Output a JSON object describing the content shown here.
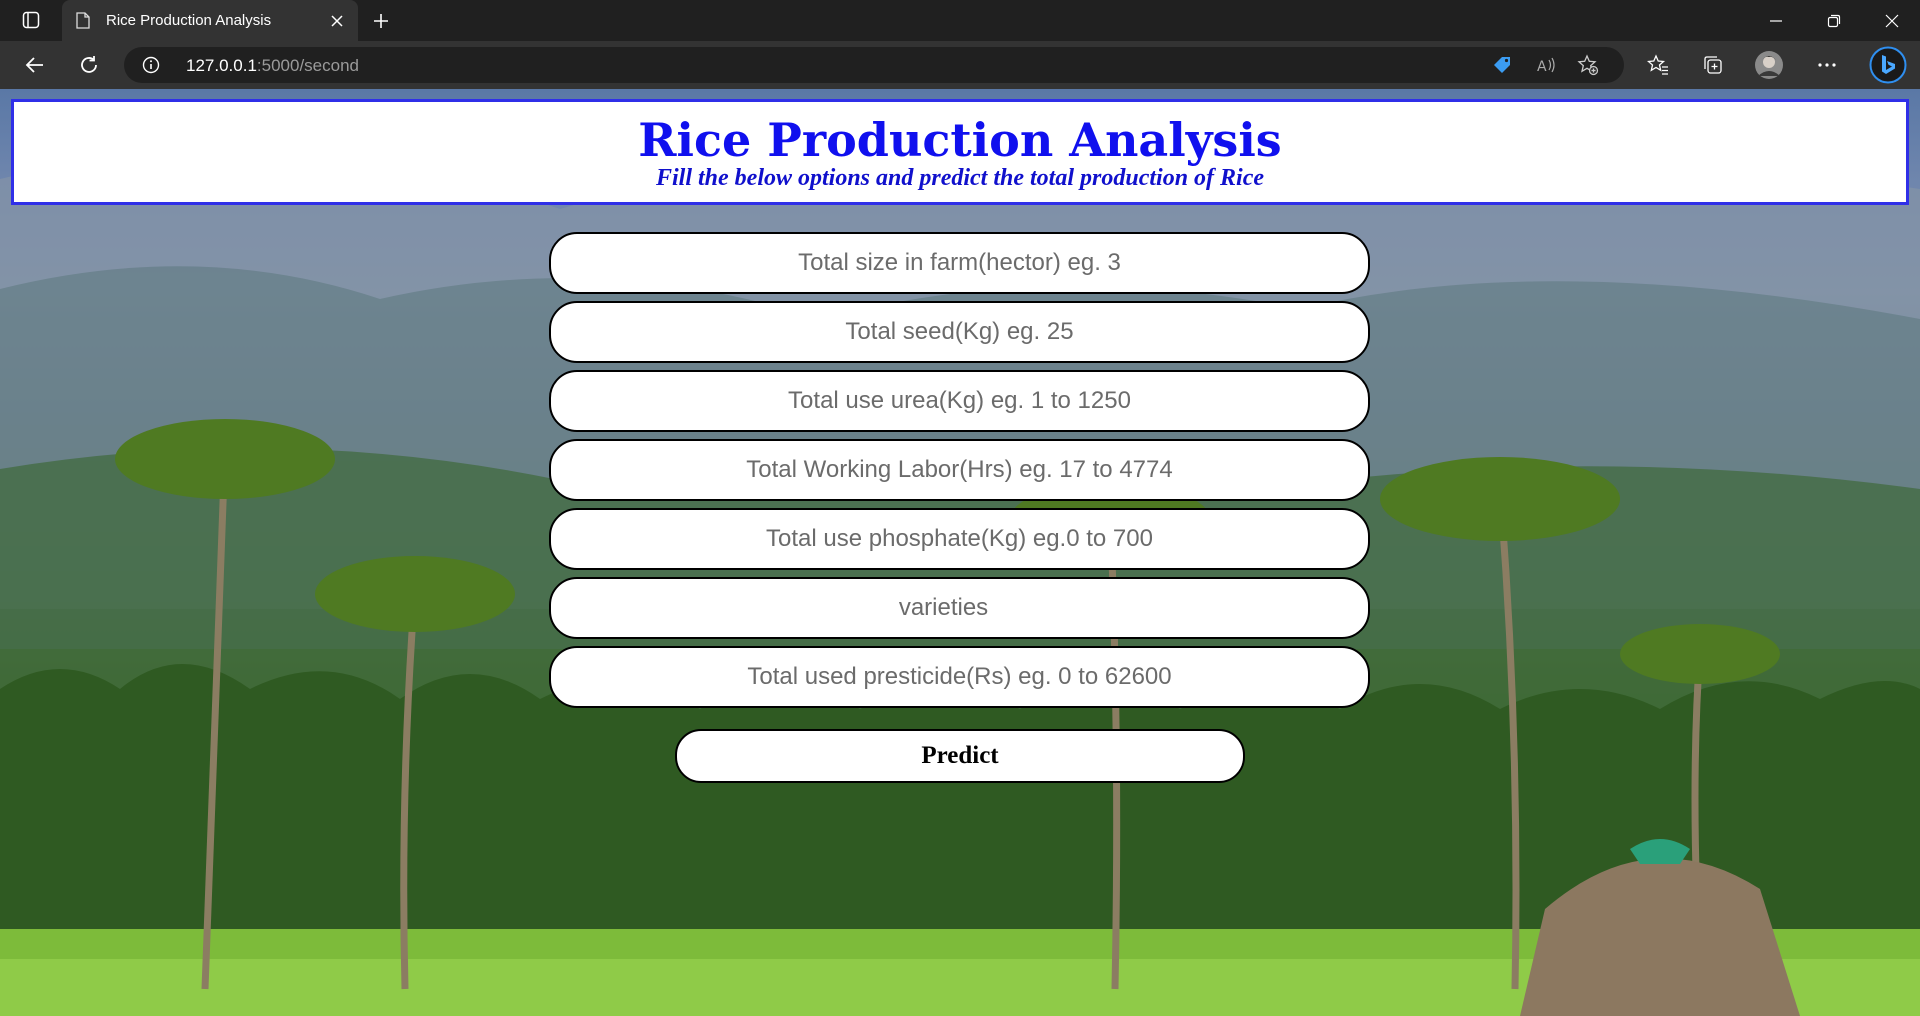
{
  "browser": {
    "tab_title": "Rice Production Analysis",
    "url_host": "127.0.0.1",
    "url_rest": ":5000/second"
  },
  "page": {
    "title": "Rice Production Analysis",
    "subtitle": "Fill the below options and predict the total production of Rice",
    "fields": [
      {
        "placeholder": "Total size in farm(hector) eg. 3"
      },
      {
        "placeholder": "Total seed(Kg) eg. 25"
      },
      {
        "placeholder": "Total use urea(Kg) eg. 1 to 1250"
      },
      {
        "placeholder": "Total Working Labor(Hrs) eg. 17 to 4774"
      },
      {
        "placeholder": "Total use phosphate(Kg) eg.0 to 700"
      },
      {
        "placeholder": "varieties"
      },
      {
        "placeholder": "Total used presticide(Rs) eg. 0 to 62600"
      }
    ],
    "predict_label": "Predict"
  },
  "colors": {
    "title_blue": "#1010ee",
    "header_border": "#2f2fe8",
    "browser_dark": "#202020",
    "browser_toolbar": "#333333"
  },
  "icons": [
    "tab-actions-icon",
    "page-favicon-icon",
    "close-icon",
    "plus-icon",
    "minimize-icon",
    "restore-icon",
    "back-icon",
    "refresh-icon",
    "info-icon",
    "tag-icon",
    "read-aloud-icon",
    "add-favorite-icon",
    "favorites-icon",
    "collections-icon",
    "profile-avatar",
    "more-icon",
    "bing-icon"
  ]
}
